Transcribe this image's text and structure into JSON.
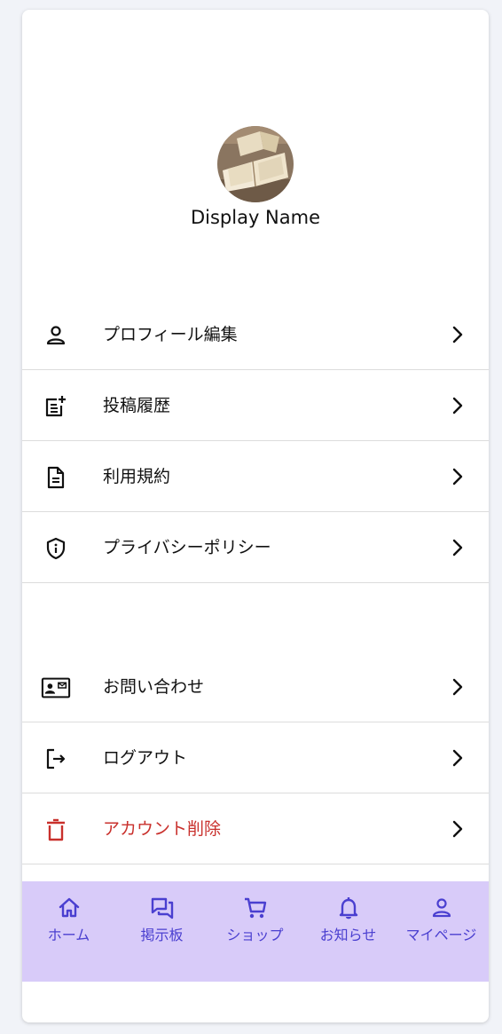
{
  "profile": {
    "display_name": "Display Name"
  },
  "menu_primary": [
    {
      "label": "プロフィール編集",
      "icon": "person-icon"
    },
    {
      "label": "投稿履歴",
      "icon": "post-add-icon"
    },
    {
      "label": "利用規約",
      "icon": "document-icon"
    },
    {
      "label": "プライバシーポリシー",
      "icon": "shield-info-icon"
    }
  ],
  "menu_secondary": [
    {
      "label": "お問い合わせ",
      "icon": "contact-card-icon"
    },
    {
      "label": "ログアウト",
      "icon": "logout-icon"
    },
    {
      "label": "アカウント削除",
      "icon": "trash-icon"
    }
  ],
  "tabs": [
    {
      "label": "ホーム",
      "icon": "home-icon"
    },
    {
      "label": "掲示板",
      "icon": "forum-icon"
    },
    {
      "label": "ショップ",
      "icon": "cart-icon"
    },
    {
      "label": "お知らせ",
      "icon": "bell-icon"
    },
    {
      "label": "マイページ",
      "icon": "person-icon"
    }
  ],
  "colors": {
    "background": "#f1f3f8",
    "tabbar": "#d8cbf9",
    "tab_accent": "#4a3fd0",
    "danger": "#c9302c"
  }
}
